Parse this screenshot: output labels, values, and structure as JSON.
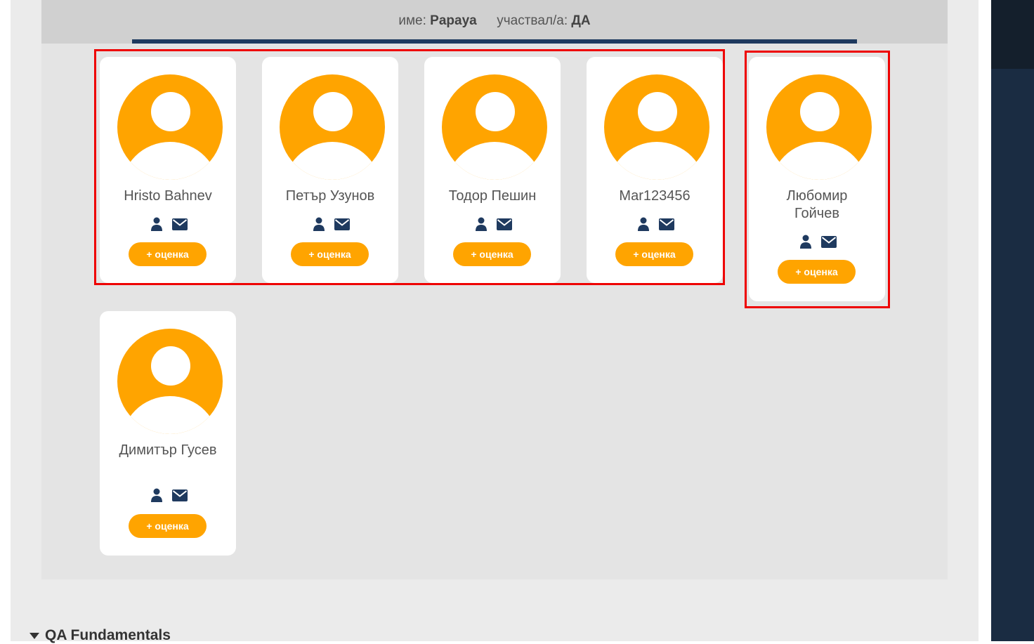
{
  "team": {
    "name_label": "име:",
    "name_value": "Papaya",
    "participated_label": "участвал/а:",
    "participated_value": "ДА"
  },
  "members": [
    {
      "name": "Hristo Bahnev",
      "button": "+ оценка"
    },
    {
      "name": "Петър Узунов",
      "button": "+ оценка"
    },
    {
      "name": "Тодор Пешин",
      "button": "+ оценка"
    },
    {
      "name": "Mar123456",
      "button": "+ оценка"
    },
    {
      "name": "Любомир Гойчев",
      "button": "+ оценка"
    },
    {
      "name": "Димитър Гусев",
      "button": "+ оценка"
    }
  ],
  "icons": [
    "user-icon",
    "envelope-icon"
  ],
  "colors": {
    "accent": "#ffa400",
    "navy": "#1f3a5f",
    "highlight": "#ee0000",
    "sidebar": "#1a2c42"
  },
  "next_section": {
    "title": "QA Fundamentals"
  }
}
